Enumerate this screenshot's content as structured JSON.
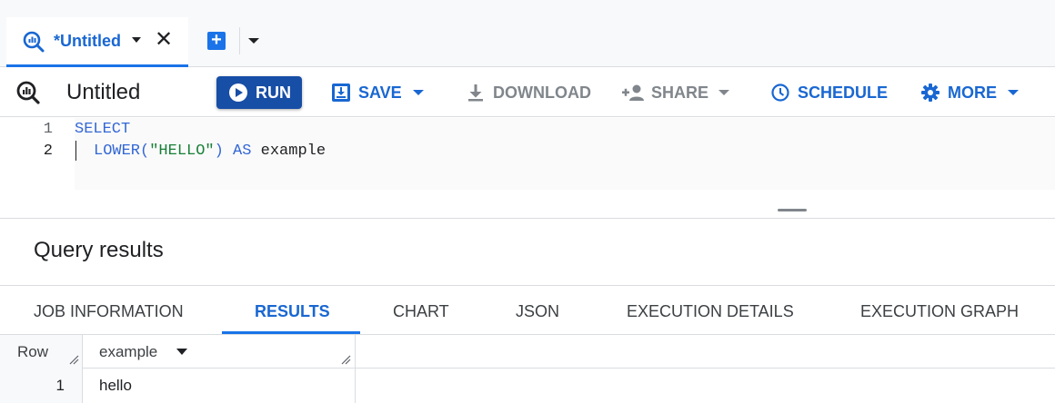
{
  "tabs": [
    {
      "title": "*Untitled",
      "icon": "query-icon",
      "close": "✕"
    }
  ],
  "new_tab": {
    "icon": "plus-icon",
    "label": "+"
  },
  "toolbar": {
    "query_title": "Untitled",
    "run_label": "RUN",
    "save_label": "SAVE",
    "download_label": "DOWNLOAD",
    "share_label": "SHARE",
    "schedule_label": "SCHEDULE",
    "more_label": "MORE"
  },
  "editor": {
    "lines": [
      {
        "num": "1",
        "tokens": [
          "SELECT"
        ]
      },
      {
        "num": "2",
        "tokens": [
          "LOWER(",
          "\"HELLO\"",
          ") ",
          "AS",
          " example"
        ]
      }
    ]
  },
  "results": {
    "title": "Query results",
    "tabs": [
      "JOB INFORMATION",
      "RESULTS",
      "CHART",
      "JSON",
      "EXECUTION DETAILS",
      "EXECUTION GRAPH"
    ],
    "active_tab": "RESULTS",
    "columns": [
      "Row",
      "example"
    ],
    "rows": [
      {
        "row": "1",
        "example": "hello"
      }
    ]
  },
  "colors": {
    "accent": "#1a73e8",
    "run_button": "#174ea6",
    "keyword": "#3367d6",
    "string": "#188038"
  }
}
